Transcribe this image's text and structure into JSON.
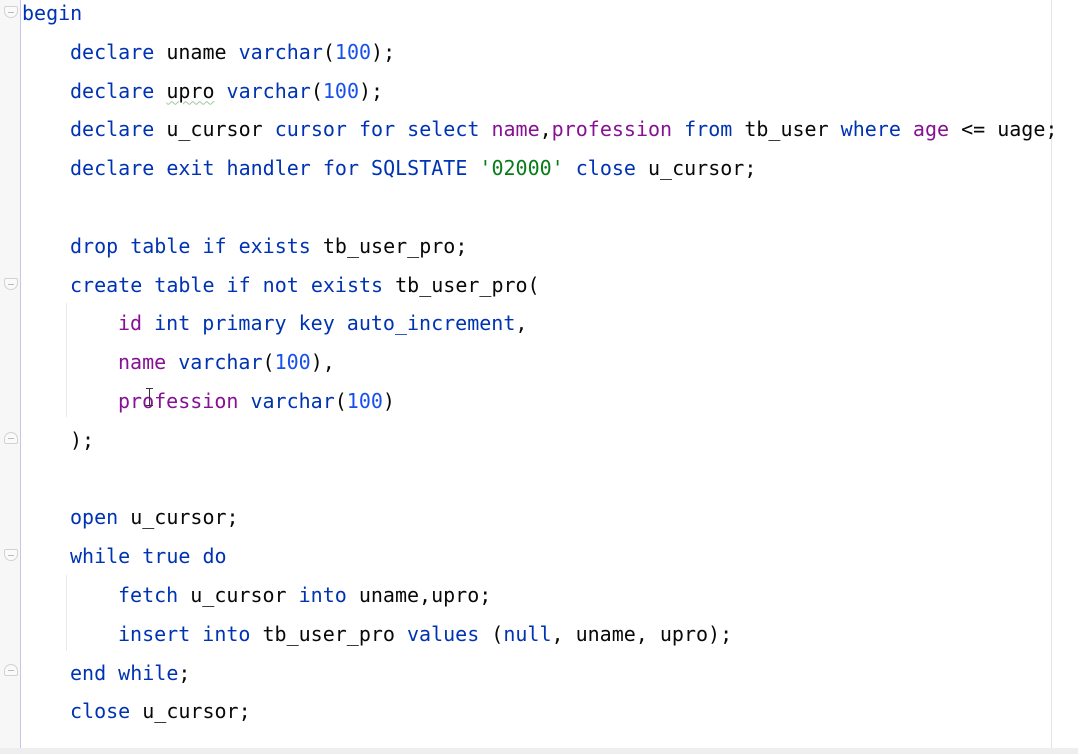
{
  "editor": {
    "colors": {
      "keyword": "#0033b3",
      "column": "#871094",
      "number": "#1750eb",
      "string": "#067d17",
      "identifier": "#080808"
    },
    "lines": [
      {
        "indent": 0,
        "tokens": [
          {
            "t": "begin",
            "c": "kw"
          }
        ]
      },
      {
        "indent": 1,
        "tokens": [
          {
            "t": "declare ",
            "c": "kw"
          },
          {
            "t": "uname ",
            "c": "id"
          },
          {
            "t": "varchar",
            "c": "kw"
          },
          {
            "t": "(",
            "c": "id"
          },
          {
            "t": "100",
            "c": "num"
          },
          {
            "t": ");",
            "c": "id"
          }
        ]
      },
      {
        "indent": 1,
        "tokens": [
          {
            "t": "declare ",
            "c": "kw"
          },
          {
            "t": "upro",
            "c": "id warn"
          },
          {
            "t": " ",
            "c": "id"
          },
          {
            "t": "varchar",
            "c": "kw"
          },
          {
            "t": "(",
            "c": "id"
          },
          {
            "t": "100",
            "c": "num"
          },
          {
            "t": ");",
            "c": "id"
          }
        ]
      },
      {
        "indent": 1,
        "tokens": [
          {
            "t": "declare ",
            "c": "kw"
          },
          {
            "t": "u_cursor ",
            "c": "id"
          },
          {
            "t": "cursor for select ",
            "c": "kw"
          },
          {
            "t": "name",
            "c": "col"
          },
          {
            "t": ",",
            "c": "id"
          },
          {
            "t": "profession ",
            "c": "col"
          },
          {
            "t": "from ",
            "c": "kw"
          },
          {
            "t": "tb_user ",
            "c": "id"
          },
          {
            "t": "where ",
            "c": "kw"
          },
          {
            "t": "age ",
            "c": "col"
          },
          {
            "t": "<= uage;",
            "c": "id"
          }
        ]
      },
      {
        "indent": 1,
        "tokens": [
          {
            "t": "declare exit handler for SQLSTATE ",
            "c": "kw"
          },
          {
            "t": "'02000' ",
            "c": "str"
          },
          {
            "t": "close ",
            "c": "kw"
          },
          {
            "t": "u_cursor;",
            "c": "id"
          }
        ]
      },
      {
        "indent": 0,
        "tokens": []
      },
      {
        "indent": 1,
        "tokens": [
          {
            "t": "drop table if exists ",
            "c": "kw"
          },
          {
            "t": "tb_user_pro;",
            "c": "id"
          }
        ]
      },
      {
        "indent": 1,
        "tokens": [
          {
            "t": "create table if not exists ",
            "c": "kw"
          },
          {
            "t": "tb_user_pro(",
            "c": "id"
          }
        ]
      },
      {
        "indent": 2,
        "tokens": [
          {
            "t": "id ",
            "c": "col"
          },
          {
            "t": "int primary key auto_increment",
            "c": "kw"
          },
          {
            "t": ",",
            "c": "id"
          }
        ]
      },
      {
        "indent": 2,
        "tokens": [
          {
            "t": "name ",
            "c": "col"
          },
          {
            "t": "varchar",
            "c": "kw"
          },
          {
            "t": "(",
            "c": "id"
          },
          {
            "t": "100",
            "c": "num"
          },
          {
            "t": "),",
            "c": "id"
          }
        ]
      },
      {
        "indent": 2,
        "tokens": [
          {
            "t": "profession ",
            "c": "col"
          },
          {
            "t": "varchar",
            "c": "kw"
          },
          {
            "t": "(",
            "c": "id"
          },
          {
            "t": "100",
            "c": "num"
          },
          {
            "t": ")",
            "c": "id"
          }
        ]
      },
      {
        "indent": 1,
        "tokens": [
          {
            "t": ");",
            "c": "id"
          }
        ]
      },
      {
        "indent": 0,
        "tokens": []
      },
      {
        "indent": 1,
        "tokens": [
          {
            "t": "open ",
            "c": "kw"
          },
          {
            "t": "u_cursor;",
            "c": "id"
          }
        ]
      },
      {
        "indent": 1,
        "tokens": [
          {
            "t": "while true do",
            "c": "kw"
          }
        ]
      },
      {
        "indent": 2,
        "tokens": [
          {
            "t": "fetch ",
            "c": "kw"
          },
          {
            "t": "u_cursor ",
            "c": "id"
          },
          {
            "t": "into ",
            "c": "kw"
          },
          {
            "t": "uname,upro;",
            "c": "id"
          }
        ]
      },
      {
        "indent": 2,
        "tokens": [
          {
            "t": "insert into ",
            "c": "kw"
          },
          {
            "t": "tb_user_pro ",
            "c": "id"
          },
          {
            "t": "values ",
            "c": "kw"
          },
          {
            "t": "(",
            "c": "id"
          },
          {
            "t": "null",
            "c": "kw"
          },
          {
            "t": ", uname, upro);",
            "c": "id"
          }
        ]
      },
      {
        "indent": 1,
        "tokens": [
          {
            "t": "end while",
            "c": "kw"
          },
          {
            "t": ";",
            "c": "id"
          }
        ]
      },
      {
        "indent": 1,
        "tokens": [
          {
            "t": "close ",
            "c": "kw"
          },
          {
            "t": "u_cursor;",
            "c": "id"
          }
        ]
      }
    ]
  }
}
